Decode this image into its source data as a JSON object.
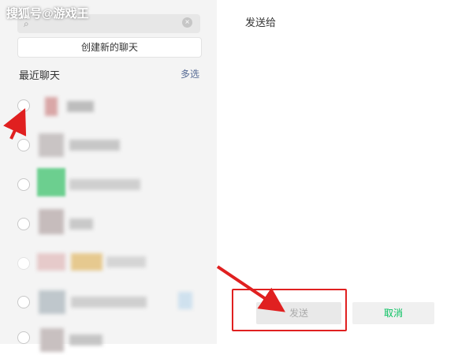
{
  "watermark": "搜狐号@游戏王",
  "left_panel": {
    "create_chat": "创建新的聊天",
    "recent_title": "最近聊天",
    "multi_select": "多选"
  },
  "right_panel": {
    "send_to": "发送给",
    "send_button": "发送",
    "cancel_button": "取消"
  },
  "icons": {
    "search": "search-icon",
    "clear": "clear-icon"
  },
  "colors": {
    "accent_green": "#07c160",
    "link_blue": "#576b95",
    "annotation_red": "#e02020"
  }
}
